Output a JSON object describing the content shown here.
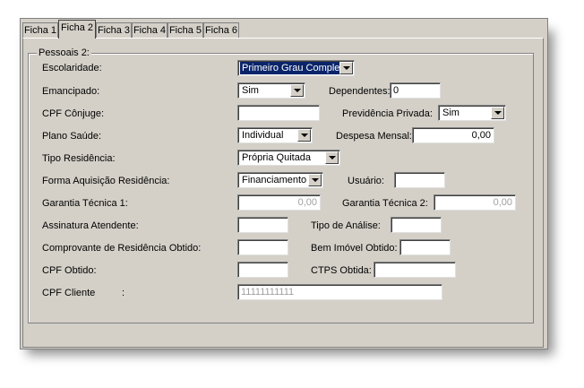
{
  "tabs": [
    {
      "label": "Ficha 1"
    },
    {
      "label": "Ficha 2"
    },
    {
      "label": "Ficha 3"
    },
    {
      "label": "Ficha 4"
    },
    {
      "label": "Ficha 5"
    },
    {
      "label": "Ficha 6"
    }
  ],
  "group_title": "Pessoais 2:",
  "form": {
    "escolaridade": {
      "label": "Escolaridade:",
      "value": "Primeiro Grau Completo"
    },
    "emancipado": {
      "label": "Emancipado:",
      "value": "Sim"
    },
    "dependentes": {
      "label": "Dependentes:",
      "value": "0"
    },
    "cpf_conjuge": {
      "label": "CPF Cônjuge:",
      "value": ""
    },
    "previdencia_privada": {
      "label": "Previdência Privada:",
      "value": "Sim"
    },
    "plano_saude": {
      "label": "Plano Saúde:",
      "value": "Individual"
    },
    "despesa_mensal": {
      "label": "Despesa Mensal:",
      "value": "0,00"
    },
    "tipo_residencia": {
      "label": "Tipo Residência:",
      "value": "Própria Quitada"
    },
    "forma_aquisicao": {
      "label": "Forma Aquisição Residência:",
      "value": "Financiamento"
    },
    "usuario": {
      "label": "Usuário:",
      "value": ""
    },
    "garantia_tecnica_1": {
      "label": "Garantia Técnica 1:",
      "value": "0,00"
    },
    "garantia_tecnica_2": {
      "label": "Garantia Técnica 2:",
      "value": "0,00"
    },
    "assinatura_atendente": {
      "label": "Assinatura Atendente:",
      "value": ""
    },
    "tipo_analise": {
      "label": "Tipo de Análise:",
      "value": ""
    },
    "comprovante_residencia": {
      "label": "Comprovante de Residência Obtido:",
      "value": ""
    },
    "bem_imovel": {
      "label": "Bem Imóvel Obtido:",
      "value": ""
    },
    "cpf_obtido": {
      "label": "CPF Obtido:",
      "value": ""
    },
    "ctps_obtida": {
      "label": "CTPS Obtida:",
      "value": ""
    },
    "cpf_cliente": {
      "label": "CPF Cliente",
      "colon": ":",
      "value": "11111111111"
    }
  },
  "colors": {
    "selection": "#0a246a",
    "face": "#d4d0c8"
  }
}
